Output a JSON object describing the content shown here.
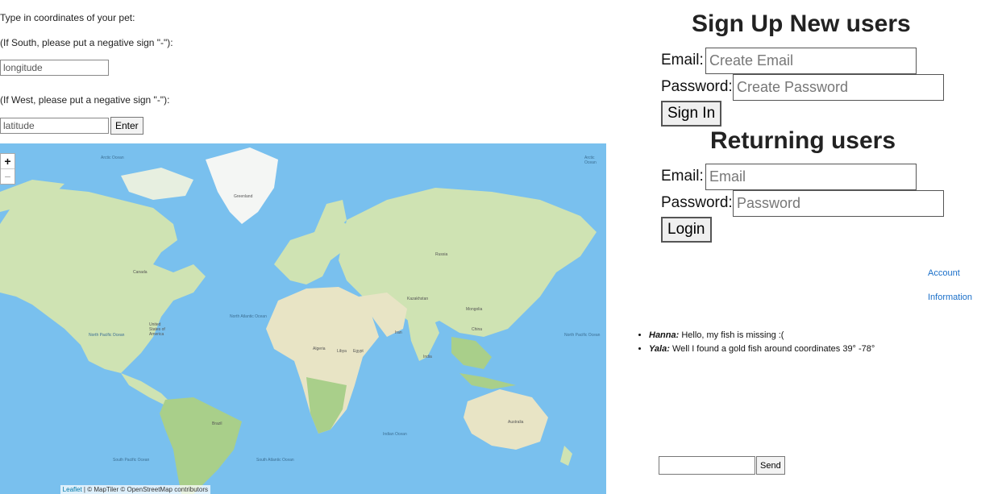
{
  "coords": {
    "intro": "Type in coordinates of your pet:",
    "south_hint": "(If South, please put a negative sign \"-\"):",
    "longitude_placeholder": "longitude",
    "west_hint": "(If West, please put a negative sign \"-\"):",
    "latitude_placeholder": "latitude",
    "enter_label": "Enter"
  },
  "map": {
    "zoom_in": "+",
    "zoom_out": "−",
    "attribution_leaflet": "Leaflet",
    "attribution_rest": " | © MapTiler © OpenStreetMap contributors",
    "ocean_color": "#79c0ee",
    "land_color": "#cfe3b3",
    "ice_color": "#f4f6f4",
    "labels": {
      "greenland": "Greenland",
      "north_atlantic": "North Atlantic Ocean",
      "north_pacific_left": "North Pacific Ocean",
      "north_pacific_right": "North Pacific Ocean",
      "south_pacific": "South Pacific Ocean",
      "south_atlantic": "South Atlantic Ocean",
      "indian_ocean": "Indian Ocean",
      "russia": "Russia",
      "canada": "Canada",
      "usa": "United States of America",
      "brazil": "Brazil",
      "china": "China",
      "australia": "Australia",
      "libya": "Libya",
      "egypt": "Egypt",
      "algeria": "Algeria",
      "iran": "Iran",
      "india": "India",
      "kazakhstan": "Kazakhstan",
      "mongolia": "Mongolia",
      "arctic_left": "Arctic Ocean",
      "arctic_right": "Arctic Ocean"
    }
  },
  "signup": {
    "title": "Sign Up New users",
    "email_label": "Email:",
    "email_placeholder": "Create Email",
    "password_label": "Password:",
    "password_placeholder": "Create Password",
    "button": "Sign In"
  },
  "login": {
    "title": "Returning users",
    "email_label": "Email:",
    "email_placeholder": "Email",
    "password_label": "Password:",
    "password_placeholder": "Password",
    "button": "Login"
  },
  "account_links": {
    "account": "Account",
    "information": "Information"
  },
  "chat": {
    "messages": [
      {
        "author": "Hanna:",
        "text": " Hello, my fish is missing :("
      },
      {
        "author": "Yala:",
        "text": " Well I found a gold fish around coordinates 39° -78°"
      }
    ],
    "send_label": "Send"
  }
}
